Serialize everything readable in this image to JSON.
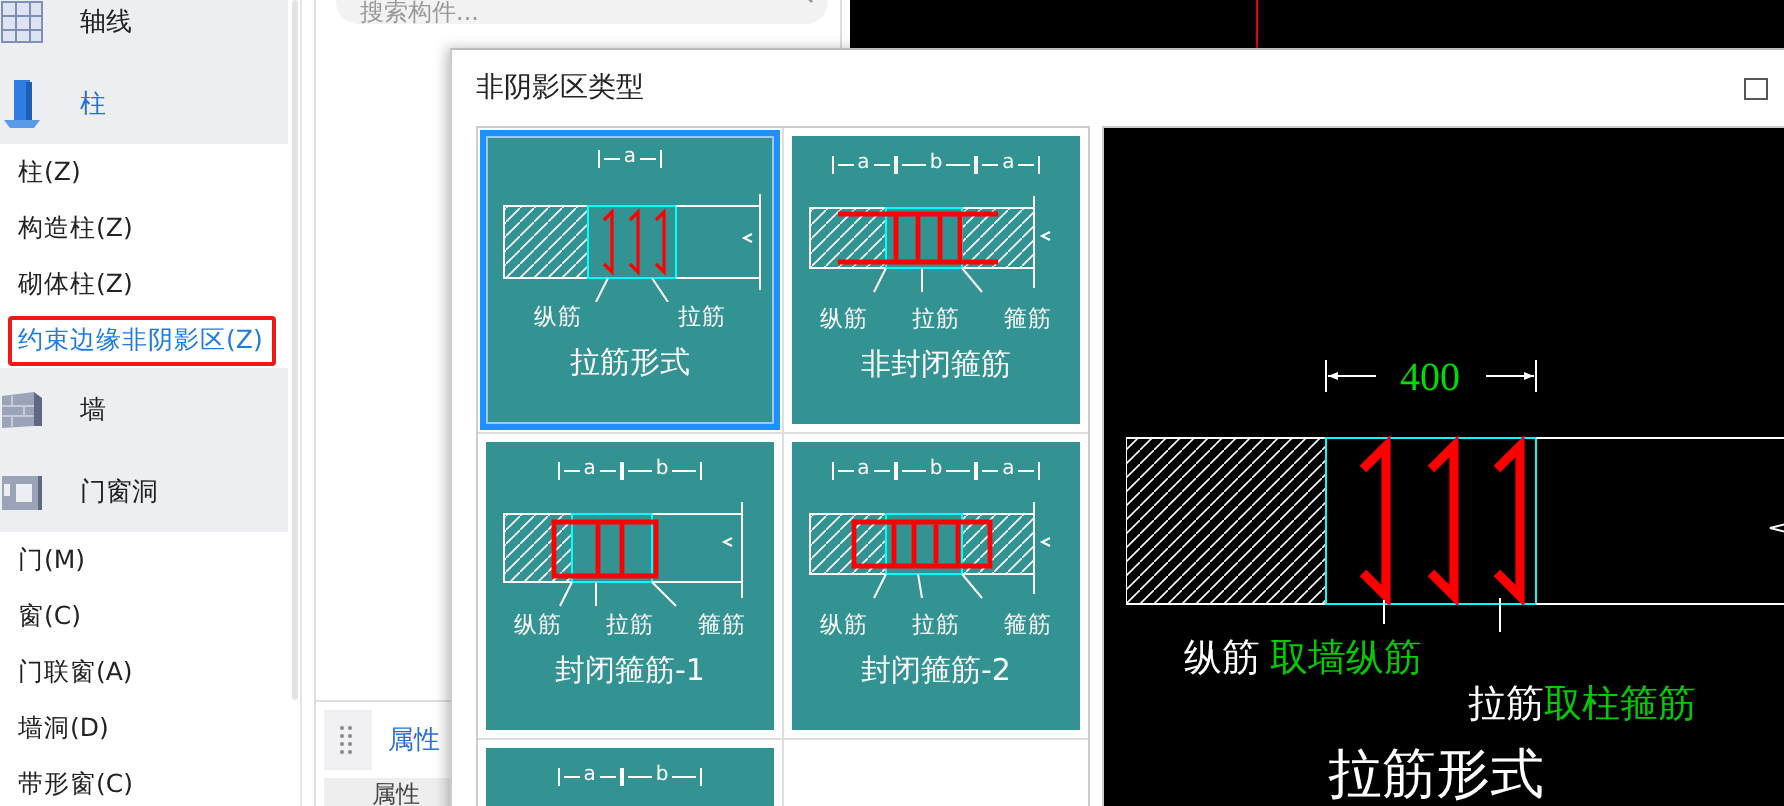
{
  "sidebar": {
    "items": [
      {
        "kind": "category",
        "label": "轴线",
        "active": false
      },
      {
        "kind": "category",
        "label": "柱",
        "active": true
      },
      {
        "kind": "item",
        "label": "柱(Z)",
        "selected": false
      },
      {
        "kind": "item",
        "label": "构造柱(Z)",
        "selected": false
      },
      {
        "kind": "item",
        "label": "砌体柱(Z)",
        "selected": false
      },
      {
        "kind": "item",
        "label": "约束边缘非阴影区(Z)",
        "selected": true
      },
      {
        "kind": "category",
        "label": "墙",
        "active": false
      },
      {
        "kind": "category",
        "label": "门窗洞",
        "active": false
      },
      {
        "kind": "item",
        "label": "门(M)",
        "selected": false
      },
      {
        "kind": "item",
        "label": "窗(C)",
        "selected": false
      },
      {
        "kind": "item",
        "label": "门联窗(A)",
        "selected": false
      },
      {
        "kind": "item",
        "label": "墙洞(D)",
        "selected": false
      },
      {
        "kind": "item",
        "label": "带形窗(C)",
        "selected": false
      }
    ]
  },
  "component_panel": {
    "search": {
      "placeholder": "搜索构件..."
    },
    "property_tab": "属性",
    "property_header": "属性"
  },
  "dialog": {
    "title": "非阴影区类型",
    "types": [
      {
        "kind": "tie",
        "title": "拉筋形式",
        "selected": true,
        "dims": [
          "a"
        ],
        "labels": [
          "纵筋",
          "拉筋"
        ]
      },
      {
        "kind": "open",
        "title": "非封闭箍筋",
        "selected": false,
        "dims": [
          "a",
          "b",
          "a"
        ],
        "labels": [
          "纵筋",
          "拉筋",
          "箍筋"
        ]
      },
      {
        "kind": "closed1",
        "title": "封闭箍筋-1",
        "selected": false,
        "dims": [
          "a",
          "b"
        ],
        "labels": [
          "纵筋",
          "拉筋",
          "箍筋"
        ]
      },
      {
        "kind": "closed2",
        "title": "封闭箍筋-2",
        "selected": false,
        "dims": [
          "a",
          "b",
          "a"
        ],
        "labels": [
          "纵筋",
          "拉筋",
          "箍筋"
        ]
      },
      {
        "kind": "partial",
        "selected": false,
        "dims": [
          "a",
          "b"
        ]
      }
    ],
    "preview": {
      "dimension": "400",
      "notes": [
        {
          "label": "纵筋",
          "value": "取墙纵筋"
        },
        {
          "label": "拉筋",
          "value": "取柱箍筋"
        }
      ],
      "title": "拉筋形式"
    }
  }
}
